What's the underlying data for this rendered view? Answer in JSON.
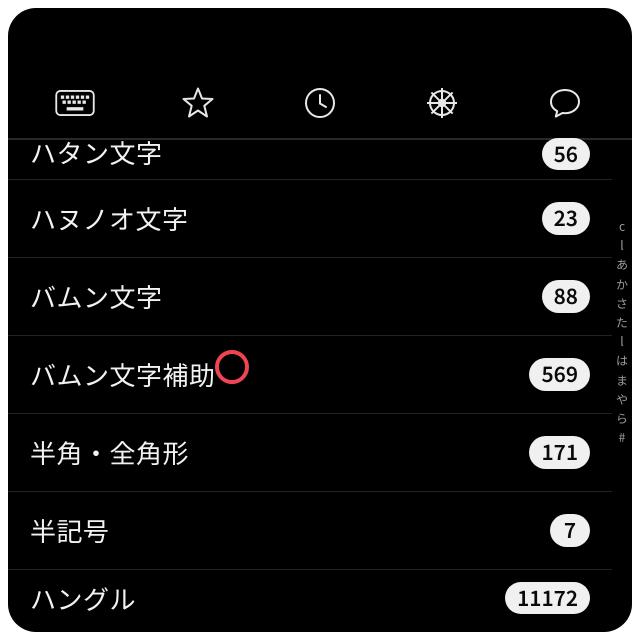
{
  "tabs": {
    "keyboard": "keyboard-icon",
    "star": "star-icon",
    "clock": "clock-icon",
    "wheel": "wheel-icon",
    "chat": "chat-icon"
  },
  "rows": [
    {
      "label": "ハタン文字",
      "count": "56"
    },
    {
      "label": "ハヌノオ文字",
      "count": "23"
    },
    {
      "label": "バムン文字",
      "count": "88"
    },
    {
      "label": "バムン文字補助",
      "count": "569"
    },
    {
      "label": "半角・全角形",
      "count": "171"
    },
    {
      "label": "半記号",
      "count": "7"
    },
    {
      "label": "ハングル",
      "count": "11172"
    }
  ],
  "index": [
    "c",
    "l",
    "あ",
    "か",
    "さ",
    "た",
    "l",
    "は",
    "ま",
    "や",
    "ら",
    "#"
  ]
}
